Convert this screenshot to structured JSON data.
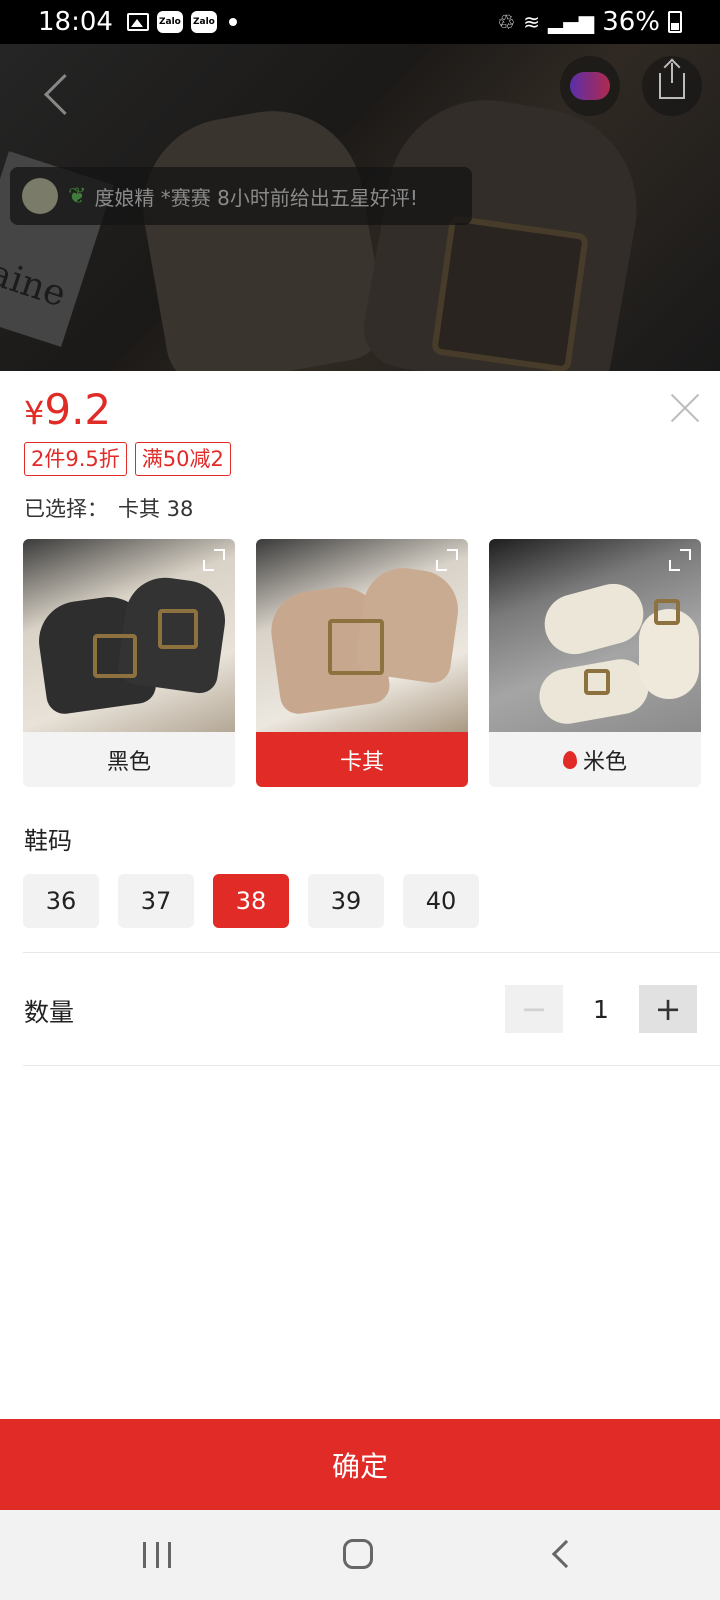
{
  "status_bar": {
    "time": "18:04",
    "battery": "36%"
  },
  "review_banner": {
    "text": "度娘精 *赛赛 8小时前给出五星好评!"
  },
  "price": {
    "currency": "¥",
    "amount": "9.2"
  },
  "promos": [
    "2件9.5折",
    "满50减2"
  ],
  "selection": {
    "label": "已选择：",
    "value": "卡其 38"
  },
  "colors": [
    {
      "label": "黑色",
      "selected": false,
      "hot": false
    },
    {
      "label": "卡其",
      "selected": true,
      "hot": false
    },
    {
      "label": "米色",
      "selected": false,
      "hot": true
    }
  ],
  "size_section": {
    "title": "鞋码",
    "options": [
      "36",
      "37",
      "38",
      "39",
      "40"
    ],
    "selected": "38"
  },
  "quantity": {
    "label": "数量",
    "value": "1",
    "minus": "−",
    "plus": "+"
  },
  "confirm_button": {
    "label": "确定"
  },
  "accent_color": "#e02b27"
}
